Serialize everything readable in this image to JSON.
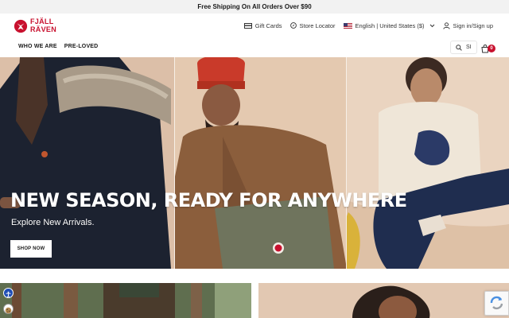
{
  "promo": {
    "text": "Free Shipping On All Orders Over $90"
  },
  "brand": {
    "line1": "FJÄLL",
    "line2": "RÄVEN",
    "color": "#c8102e"
  },
  "utility_nav": {
    "gift_cards": "Gift Cards",
    "store_locator": "Store Locator",
    "locale": "English | United States ($)",
    "sign_in": "Sign in/Sign up"
  },
  "main_nav": {
    "items": [
      "WHO WE ARE",
      "PRE-LOVED"
    ]
  },
  "search": {
    "value": "SI"
  },
  "cart": {
    "count": "0"
  },
  "hero": {
    "title": "NEW SEASON, READY FOR ANYWHERE",
    "subtitle": "Explore New Arrivals.",
    "cta": "SHOP NOW"
  },
  "icons": [
    "gift-card-icon",
    "compass-icon",
    "us-flag-icon",
    "chevron-down-icon",
    "user-icon",
    "search-icon",
    "cart-icon",
    "accessibility-icon",
    "cookie-icon",
    "recaptcha-icon"
  ]
}
